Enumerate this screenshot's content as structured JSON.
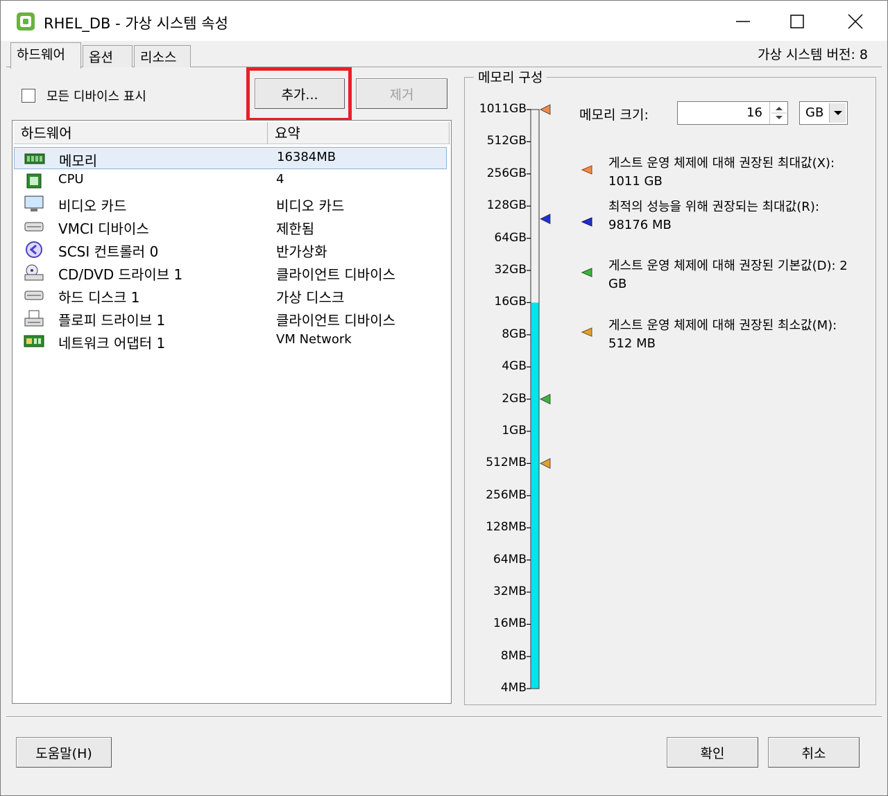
{
  "window": {
    "title": "RHEL_DB - 가상 시스템 속성",
    "version_label": "가상 시스템 버전: 8"
  },
  "tabs": [
    {
      "label": "하드웨어"
    },
    {
      "label": "옵션"
    },
    {
      "label": "리소스"
    }
  ],
  "toolbar": {
    "show_all_devices": "모든 디바이스 표시",
    "add_label": "추가...",
    "remove_label": "제거"
  },
  "hardware_table": {
    "headers": [
      "하드웨어",
      "요약"
    ],
    "rows": [
      {
        "name": "메모리",
        "summary": "16384MB",
        "icon": "memory-icon"
      },
      {
        "name": "CPU",
        "summary": "4",
        "icon": "cpu-icon"
      },
      {
        "name": "비디오 카드",
        "summary": "비디오 카드",
        "icon": "monitor-icon"
      },
      {
        "name": "VMCI 디바이스",
        "summary": "제한됨",
        "icon": "device-icon"
      },
      {
        "name": "SCSI 컨트롤러 0",
        "summary": "반가상화",
        "icon": "scsi-icon"
      },
      {
        "name": "CD/DVD 드라이브 1",
        "summary": "클라이언트 디바이스",
        "icon": "cd-icon"
      },
      {
        "name": "하드 디스크 1",
        "summary": "가상 디스크",
        "icon": "disk-icon"
      },
      {
        "name": "플로피 드라이브 1",
        "summary": "클라이언트 디바이스",
        "icon": "floppy-icon"
      },
      {
        "name": "네트워크 어댑터 1",
        "summary": "VM Network",
        "icon": "network-icon"
      }
    ]
  },
  "memory_config": {
    "group_title": "메모리 구성",
    "size_label": "메모리 크기:",
    "size_value": "16",
    "unit": "GB",
    "scale_labels": [
      "1011GB",
      "512GB",
      "256GB",
      "128GB",
      "64GB",
      "32GB",
      "16GB",
      "8GB",
      "4GB",
      "2GB",
      "1GB",
      "512MB",
      "256MB",
      "128MB",
      "64MB",
      "32MB",
      "16MB",
      "8MB",
      "4MB"
    ],
    "legend": [
      {
        "text": "게스트 운영 체제에 대해 권장된 최대값(X): 1011 GB",
        "color": "#f08a4b"
      },
      {
        "text": "최적의 성능을 위해 권장되는 최대값(R): 98176 MB",
        "color": "#1f2fd0"
      },
      {
        "text": "게스트 운영 체제에 대해 권장된 기본값(D): 2 GB",
        "color": "#3cb43c"
      },
      {
        "text": "게스트 운영 체제에 대해 권장된 최소값(M): 512 MB",
        "color": "#e0a030"
      }
    ],
    "fill_color": "#00e5ee"
  },
  "footer": {
    "help_label": "도움말(H)",
    "ok_label": "확인",
    "cancel_label": "취소"
  }
}
